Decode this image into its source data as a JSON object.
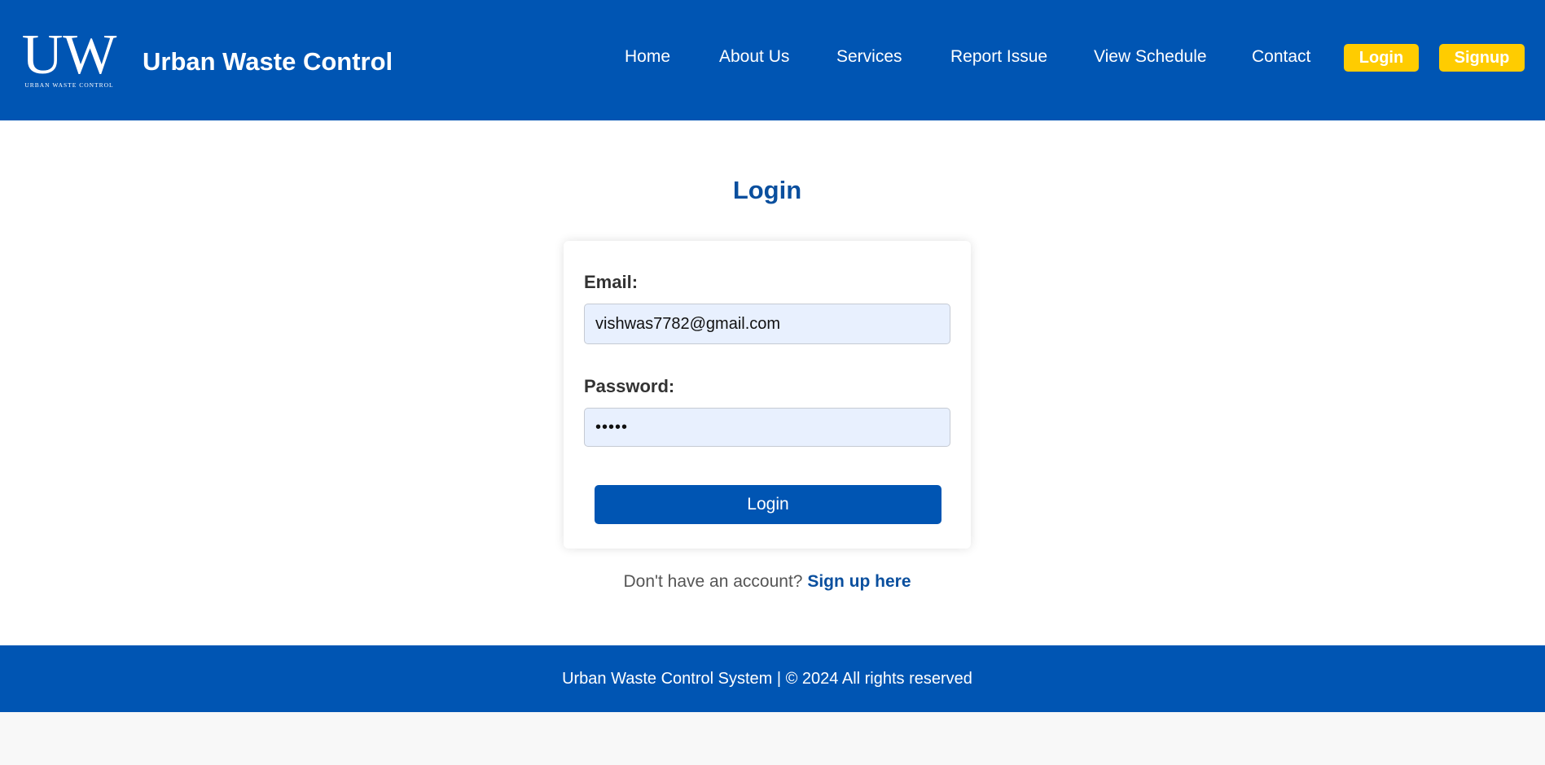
{
  "header": {
    "logo_letters": "UW",
    "logo_subtext": "URBAN WASTE CONTROL",
    "site_title": "Urban Waste Control",
    "nav": {
      "home": "Home",
      "about": "About Us",
      "services": "Services",
      "report": "Report Issue",
      "schedule": "View Schedule",
      "contact": "Contact"
    },
    "login_button": "Login",
    "signup_button": "Signup"
  },
  "main": {
    "title": "Login",
    "form": {
      "email_label": "Email:",
      "email_value": "vishwas7782@gmail.com",
      "password_label": "Password:",
      "password_value": "•••••",
      "submit_label": "Login"
    },
    "signup_prompt": "Don't have an account?",
    "signup_link": "Sign up here"
  },
  "footer": {
    "text": "Urban Waste Control System | © 2024 All rights reserved"
  },
  "colors": {
    "brand_blue": "#0055b3",
    "accent_yellow": "#ffcc00",
    "title_blue": "#0a4f9e",
    "input_bg": "#e8f0fe"
  }
}
